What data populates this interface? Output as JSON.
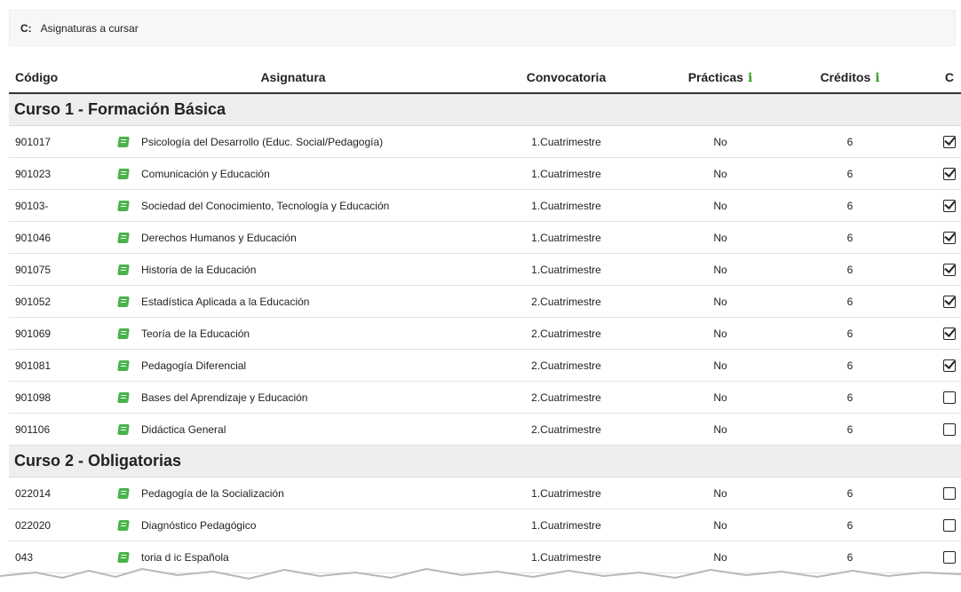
{
  "legend": {
    "code": "C:",
    "description": "Asignaturas a cursar"
  },
  "table": {
    "headers": {
      "codigo": "Código",
      "asignatura": "Asignatura",
      "convocatoria": "Convocatoria",
      "practicas": "Prácticas",
      "creditos": "Créditos",
      "c": "C",
      "info_glyph": "i"
    },
    "groups": [
      {
        "title": "Curso 1 - Formación Básica",
        "rows": [
          {
            "code": "901017",
            "subject": "Psicología del Desarrollo (Educ. Social/Pedagogía)",
            "term": "1.Cuatrimestre",
            "practicas": "No",
            "creditos": "6",
            "checked": true
          },
          {
            "code": "901023",
            "subject": "Comunicación y Educación",
            "term": "1.Cuatrimestre",
            "practicas": "No",
            "creditos": "6",
            "checked": true
          },
          {
            "code": "90103-",
            "subject": "Sociedad del Conocimiento, Tecnología y Educación",
            "term": "1.Cuatrimestre",
            "practicas": "No",
            "creditos": "6",
            "checked": true
          },
          {
            "code": "901046",
            "subject": "Derechos Humanos y Educación",
            "term": "1.Cuatrimestre",
            "practicas": "No",
            "creditos": "6",
            "checked": true
          },
          {
            "code": "901075",
            "subject": "Historia de la Educación",
            "term": "1.Cuatrimestre",
            "practicas": "No",
            "creditos": "6",
            "checked": true
          },
          {
            "code": "901052",
            "subject": "Estadística Aplicada a la Educación",
            "term": "2.Cuatrimestre",
            "practicas": "No",
            "creditos": "6",
            "checked": true
          },
          {
            "code": "901069",
            "subject": "Teoría de la Educación",
            "term": "2.Cuatrimestre",
            "practicas": "No",
            "creditos": "6",
            "checked": true
          },
          {
            "code": "901081",
            "subject": "Pedagogía Diferencial",
            "term": "2.Cuatrimestre",
            "practicas": "No",
            "creditos": "6",
            "checked": true
          },
          {
            "code": "901098",
            "subject": "Bases del Aprendizaje y Educación",
            "term": "2.Cuatrimestre",
            "practicas": "No",
            "creditos": "6",
            "checked": false
          },
          {
            "code": "901106",
            "subject": "Didáctica General",
            "term": "2.Cuatrimestre",
            "practicas": "No",
            "creditos": "6",
            "checked": false
          }
        ]
      },
      {
        "title": "Curso 2 - Obligatorias",
        "rows": [
          {
            "code": "022014",
            "subject": "Pedagogía de la Socialización",
            "term": "1.Cuatrimestre",
            "practicas": "No",
            "creditos": "6",
            "checked": false
          },
          {
            "code": "022020",
            "subject": "Diagnóstico Pedagógico",
            "term": "1.Cuatrimestre",
            "practicas": "No",
            "creditos": "6",
            "checked": false
          },
          {
            "code": "043",
            "subject": "toria d ic Española",
            "term": "1.Cuatrimestre",
            "practicas": "No",
            "creditos": "6",
            "checked": false
          }
        ]
      }
    ]
  },
  "colors": {
    "accent_green": "#3c9f2a",
    "book_icon": "#4ab34a",
    "group_bg": "#eeeeee"
  },
  "icons": {
    "row_icon": "book-icon",
    "info_icon": "info-icon",
    "check_icon": "checkbox-icon"
  }
}
